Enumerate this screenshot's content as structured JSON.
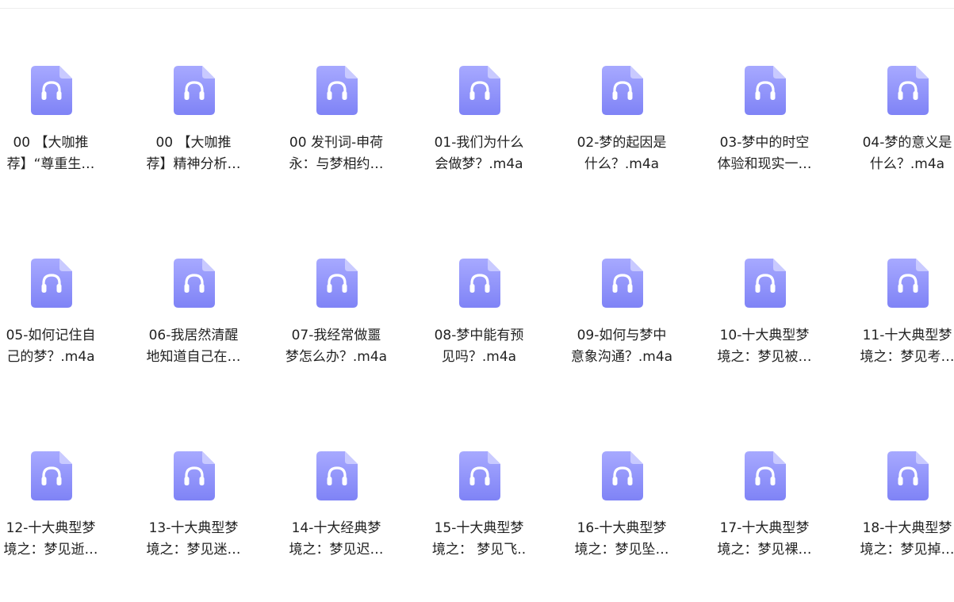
{
  "files": [
    {
      "line1": "00 【大咖推",
      "line2": "荐】“尊重生…"
    },
    {
      "line1": "00 【大咖推",
      "line2": "荐】精神分析…"
    },
    {
      "line1": "00 发刊词-申荷",
      "line2": "永：与梦相约…"
    },
    {
      "line1": "01-我们为什么",
      "line2": "会做梦？.m4a"
    },
    {
      "line1": "02-梦的起因是",
      "line2": "什么？.m4a"
    },
    {
      "line1": "03-梦中的时空",
      "line2": "体验和现实一…"
    },
    {
      "line1": "04-梦的意义是",
      "line2": "什么？.m4a"
    },
    {
      "line1": "05-如何记住自",
      "line2": "己的梦？.m4a"
    },
    {
      "line1": "06-我居然清醒",
      "line2": "地知道自己在…"
    },
    {
      "line1": "07-我经常做噩",
      "line2": "梦怎么办？.m4a"
    },
    {
      "line1": "08-梦中能有预",
      "line2": "见吗？.m4a"
    },
    {
      "line1": "09-如何与梦中",
      "line2": "意象沟通？.m4a"
    },
    {
      "line1": "10-十大典型梦",
      "line2": "境之：梦见被…"
    },
    {
      "line1": "11-十大典型梦",
      "line2": "境之：梦见考…"
    },
    {
      "line1": "12-十大典型梦",
      "line2": "境之：梦见逝…"
    },
    {
      "line1": "13-十大典型梦",
      "line2": "境之：梦见迷…"
    },
    {
      "line1": "14-十大经典梦",
      "line2": "境之：梦见迟…"
    },
    {
      "line1": "15-十大典型梦",
      "line2": "境之： 梦见飞.."
    },
    {
      "line1": "16-十大典型梦",
      "line2": "境之：梦见坠…"
    },
    {
      "line1": "17-十大典型梦",
      "line2": "境之：梦见裸…"
    },
    {
      "line1": "18-十大典型梦",
      "line2": "境之：梦见掉…"
    }
  ],
  "icon": {
    "name": "audio-file-icon",
    "gradient_top": "#a7a9ff",
    "gradient_bottom": "#7f83f6",
    "fold_color": "#c9caff",
    "glyph_color": "#ffffff"
  }
}
